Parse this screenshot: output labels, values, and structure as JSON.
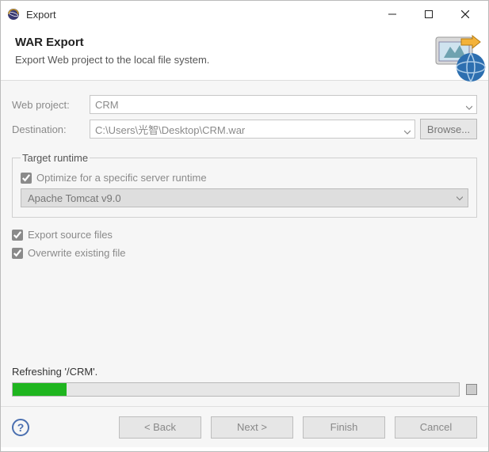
{
  "window": {
    "title": "Export",
    "minimize_aria": "Minimize",
    "maximize_aria": "Maximize",
    "close_aria": "Close"
  },
  "header": {
    "title": "WAR Export",
    "subtitle": "Export Web project to the local file system."
  },
  "form": {
    "web_project_label": "Web project:",
    "web_project_value": "CRM",
    "destination_label": "Destination:",
    "destination_value": "C:\\Users\\光智\\Desktop\\CRM.war",
    "browse_label": "Browse..."
  },
  "runtime_group": {
    "legend": "Target runtime",
    "optimize_label": "Optimize for a specific server runtime",
    "optimize_checked": true,
    "server_value": "Apache Tomcat v9.0"
  },
  "options": {
    "export_source_label": "Export source files",
    "export_source_checked": true,
    "overwrite_label": "Overwrite existing file",
    "overwrite_checked": true
  },
  "progress": {
    "label": "Refreshing '/CRM'.",
    "percent": 12
  },
  "footer": {
    "help_aria": "Help",
    "back": "< Back",
    "next": "Next >",
    "finish": "Finish",
    "cancel": "Cancel"
  }
}
